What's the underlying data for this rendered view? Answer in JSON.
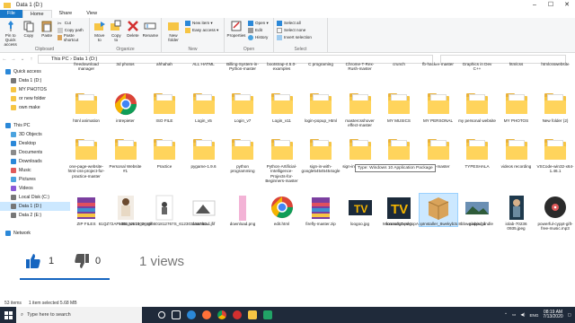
{
  "window": {
    "title": "Data 1 (D:)",
    "controls": [
      "–",
      "☐",
      "✕"
    ]
  },
  "ribbon_tabs": [
    "File",
    "Home",
    "Share",
    "View"
  ],
  "ribbon": {
    "clipboard": {
      "pin": "Pin to Quick access",
      "copy": "Copy",
      "paste": "Paste",
      "cut": "Cut",
      "copy_path": "Copy path",
      "paste_shortcut": "Paste shortcut",
      "label": "Clipboard"
    },
    "organize": {
      "move_to": "Move to",
      "copy_to": "Copy to",
      "delete": "Delete",
      "rename": "Rename",
      "label": "Organize"
    },
    "new": {
      "new_folder": "New folder",
      "new_item": "New item ▾",
      "easy_access": "Easy access ▾",
      "label": "New"
    },
    "open": {
      "properties": "Properties",
      "open": "Open ▾",
      "edit": "Edit",
      "history": "History",
      "label": "Open"
    },
    "select": {
      "select_all": "Select all",
      "select_none": "Select none",
      "invert": "Invert selection",
      "label": "Select"
    }
  },
  "address": {
    "path": "This PC  ›  Data 1 (D:)"
  },
  "nav": [
    {
      "label": "Quick access",
      "color": "#2b88d8",
      "indent": 1,
      "sel": false
    },
    {
      "label": "Data 1 (D:)",
      "color": "#777",
      "indent": 2,
      "sel": false
    },
    {
      "label": "MY PHOTOS",
      "color": "#f6c544",
      "indent": 2,
      "sel": false
    },
    {
      "label": "or new folder",
      "color": "#f6c544",
      "indent": 2,
      "sel": false
    },
    {
      "label": "own make",
      "color": "#f6c544",
      "indent": 2,
      "sel": false
    },
    {
      "label": "",
      "color": "",
      "indent": 0,
      "sel": false
    },
    {
      "label": "This PC",
      "color": "#2b88d8",
      "indent": 1,
      "sel": false
    },
    {
      "label": "3D Objects",
      "color": "#4aa3df",
      "indent": 2,
      "sel": false
    },
    {
      "label": "Desktop",
      "color": "#2b88d8",
      "indent": 2,
      "sel": false
    },
    {
      "label": "Documents",
      "color": "#8a8a8a",
      "indent": 2,
      "sel": false
    },
    {
      "label": "Downloads",
      "color": "#2b88d8",
      "indent": 2,
      "sel": false
    },
    {
      "label": "Music",
      "color": "#e05a5a",
      "indent": 2,
      "sel": false
    },
    {
      "label": "Pictures",
      "color": "#4aa3df",
      "indent": 2,
      "sel": false
    },
    {
      "label": "Videos",
      "color": "#8a5ad8",
      "indent": 2,
      "sel": false
    },
    {
      "label": "Local Disk (C:)",
      "color": "#777",
      "indent": 2,
      "sel": false
    },
    {
      "label": "Data 1 (D:)",
      "color": "#777",
      "indent": 2,
      "sel": true
    },
    {
      "label": "Data 2 (E:)",
      "color": "#777",
      "indent": 2,
      "sel": false
    },
    {
      "label": "",
      "color": "",
      "indent": 0,
      "sel": false
    },
    {
      "label": "Network",
      "color": "#2b88d8",
      "indent": 1,
      "sel": false
    }
  ],
  "files": [
    {
      "label": "freedownload manager",
      "kind": "top"
    },
    {
      "label": "3d photos",
      "kind": "top"
    },
    {
      "label": "ahhahah",
      "kind": "top"
    },
    {
      "label": "ALL HATML",
      "kind": "top"
    },
    {
      "label": "Billing-System-in-Python-master",
      "kind": "top"
    },
    {
      "label": "bootstrap-4.5.0-examples",
      "kind": "top"
    },
    {
      "label": "C programing",
      "kind": "top"
    },
    {
      "label": "Chrome-T-Rex-Rush-master",
      "kind": "top"
    },
    {
      "label": "crunch",
      "kind": "top"
    },
    {
      "label": "fb-hacker-master",
      "kind": "top"
    },
    {
      "label": "Graphics in Dev C++",
      "kind": "top"
    },
    {
      "label": "htmlcss",
      "kind": "top"
    },
    {
      "label": "htmlcsswebsite",
      "kind": "top"
    },
    {
      "label": "html animation",
      "kind": "folder"
    },
    {
      "label": "intrepieter",
      "kind": "chrome"
    },
    {
      "label": "ISO FILE",
      "kind": "folder"
    },
    {
      "label": "Login_v5",
      "kind": "folder"
    },
    {
      "label": "Login_v7",
      "kind": "folder"
    },
    {
      "label": "Login_v11",
      "kind": "folder"
    },
    {
      "label": "login-popup_Html",
      "kind": "folder"
    },
    {
      "label": "mastercsshover effect-master",
      "kind": "folder"
    },
    {
      "label": "MY MUSICS",
      "kind": "folder"
    },
    {
      "label": "MY PERSONAL",
      "kind": "folder"
    },
    {
      "label": "my personal website",
      "kind": "folder"
    },
    {
      "label": "MY PHOTOS",
      "kind": "folder"
    },
    {
      "label": "New folder (2)",
      "kind": "folder"
    },
    {
      "label": "one-page-website-html-css-project-for-practice-master",
      "kind": "folder"
    },
    {
      "label": "Personal Website #1",
      "kind": "folder"
    },
    {
      "label": "Practice",
      "kind": "folder"
    },
    {
      "label": "pygame-1.9.6",
      "kind": "folder"
    },
    {
      "label": "python programming",
      "kind": "folder"
    },
    {
      "label": "Python-Artificial-Intelligence-Projects-for-Beginners-master",
      "kind": "folder"
    },
    {
      "label": "sign-in-with-google54545454ogle",
      "kind": "folder"
    },
    {
      "label": "sign-in-with-google",
      "kind": "folder"
    },
    {
      "label": "Tally",
      "kind": "folder"
    },
    {
      "label": "trape-master",
      "kind": "folder"
    },
    {
      "label": "TYPESHALA",
      "kind": "folder"
    },
    {
      "label": "videos recording",
      "kind": "folder"
    },
    {
      "label": "VSCode-win32-x64-1.46.1",
      "kind": "folder"
    },
    {
      "label": "ZIP FILES",
      "kind": "rar"
    },
    {
      "label": "61QZ72APHOL_UL1000_.gif",
      "kind": "photo"
    },
    {
      "label": "106534974_26806601812767S_612303181350...",
      "kind": "photo2"
    },
    {
      "label": "download.jfif",
      "kind": "photo3"
    },
    {
      "label": "download.png",
      "kind": "pink"
    },
    {
      "label": "edit.html",
      "kind": "chrome"
    },
    {
      "label": "firefly-master.zip",
      "kind": "rar"
    },
    {
      "label": "loogoo.jpg",
      "kind": "tv"
    },
    {
      "label": "looooogo.png",
      "kind": "tv2"
    },
    {
      "label": "Microsoft.DesktopAppInstaller_8wekyb3d8bbwe.appxbundle",
      "kind": "box"
    },
    {
      "label": "globis.gif",
      "kind": "landscape"
    },
    {
      "label": "iolab-70236 0935.jpeg",
      "kind": "person"
    },
    {
      "label": "powerful-cyppt-gift-free-music.mp3",
      "kind": "music"
    }
  ],
  "tooltip": "Type: Windows 10 Application Package",
  "likebar": {
    "likes": "1",
    "dislikes": "0",
    "views": "1 views"
  },
  "status": {
    "count": "53 items",
    "selected": "1 item selected  5.68 MB"
  },
  "taskbar": {
    "search_placeholder": "Type here to search",
    "time": "08:19 AM",
    "date": "7/13/2020",
    "lang": "ENG"
  }
}
